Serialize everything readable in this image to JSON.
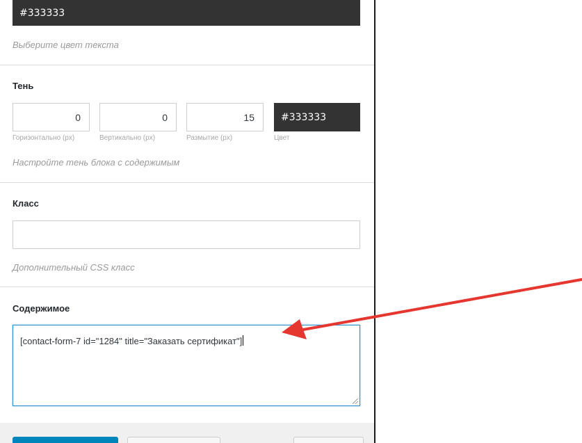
{
  "text_color": {
    "value": "#333333",
    "hint": "Выберите цвет текста"
  },
  "shadow": {
    "title": "Тень",
    "horizontal": {
      "value": "0",
      "label": "Горизонтально (px)"
    },
    "vertical": {
      "value": "0",
      "label": "Вертикально (px)"
    },
    "blur": {
      "value": "15",
      "label": "Размытие (px)"
    },
    "color": {
      "value": "#333333",
      "label": "Цвет"
    },
    "hint": "Настройте тень блока с содержимым"
  },
  "class_section": {
    "title": "Класс",
    "value": "",
    "hint": "Дополнительный CSS класс"
  },
  "content_section": {
    "title": "Содержимое",
    "value": "[contact-form-7 id=\"1284\" title=\"Заказать сертификат\"]"
  },
  "colors": {
    "swatch": "#333333",
    "focus_border": "#2d8fcf",
    "annotation_arrow": "#e5372f",
    "primary_button": "#0085ba"
  }
}
